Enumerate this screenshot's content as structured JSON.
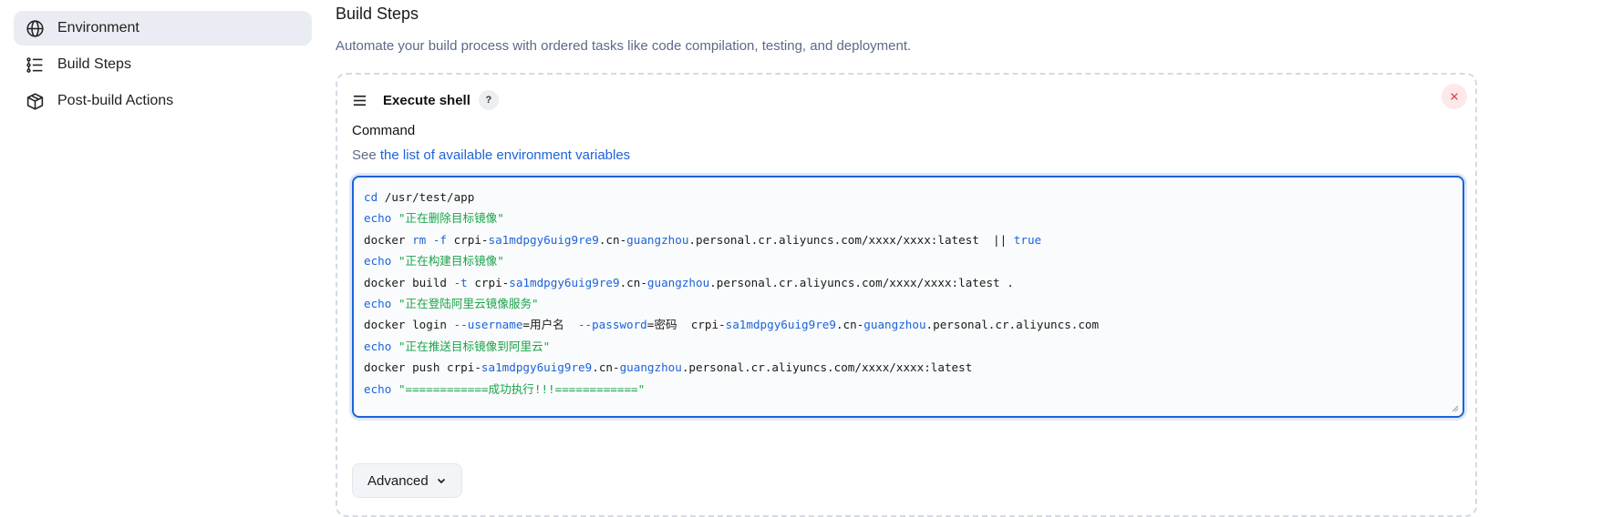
{
  "sidebar": {
    "items": [
      {
        "label": "Environment",
        "icon": "globe-icon",
        "active": true
      },
      {
        "label": "Build Steps",
        "icon": "list-icon",
        "active": false
      },
      {
        "label": "Post-build Actions",
        "icon": "package-icon",
        "active": false
      }
    ]
  },
  "section": {
    "title": "Build Steps",
    "description": "Automate your build process with ordered tasks like code compilation, testing, and deployment."
  },
  "step": {
    "title": "Execute shell",
    "help": "?",
    "field_label": "Command",
    "help_prefix": "See ",
    "help_link": "the list of available environment variables",
    "code_lines": [
      [
        {
          "t": "kw",
          "v": "cd"
        },
        {
          "t": "p",
          "v": " /usr/test/app"
        }
      ],
      [
        {
          "t": "kw",
          "v": "echo"
        },
        {
          "t": "p",
          "v": " "
        },
        {
          "t": "str",
          "v": "\"正在删除目标镜像\""
        }
      ],
      [
        {
          "t": "p",
          "v": "docker "
        },
        {
          "t": "kw",
          "v": "rm -f"
        },
        {
          "t": "p",
          "v": " crpi-"
        },
        {
          "t": "kw",
          "v": "sa1mdpgy6uig9re9"
        },
        {
          "t": "p",
          "v": ".cn-"
        },
        {
          "t": "kw",
          "v": "guangzhou"
        },
        {
          "t": "p",
          "v": ".personal.cr.aliyuncs.com/xxxx/xxxx:latest  || "
        },
        {
          "t": "kw",
          "v": "true"
        }
      ],
      [
        {
          "t": "kw",
          "v": "echo"
        },
        {
          "t": "p",
          "v": " "
        },
        {
          "t": "str",
          "v": "\"正在构建目标镜像\""
        }
      ],
      [
        {
          "t": "p",
          "v": "docker build "
        },
        {
          "t": "kw",
          "v": "-t"
        },
        {
          "t": "p",
          "v": " crpi-"
        },
        {
          "t": "kw",
          "v": "sa1mdpgy6uig9re9"
        },
        {
          "t": "p",
          "v": ".cn-"
        },
        {
          "t": "kw",
          "v": "guangzhou"
        },
        {
          "t": "p",
          "v": ".personal.cr.aliyuncs.com/xxxx/xxxx:latest ."
        }
      ],
      [
        {
          "t": "kw",
          "v": "echo"
        },
        {
          "t": "p",
          "v": " "
        },
        {
          "t": "str",
          "v": "\"正在登陆阿里云镜像服务\""
        }
      ],
      [
        {
          "t": "p",
          "v": "docker login "
        },
        {
          "t": "kw",
          "v": "--username"
        },
        {
          "t": "p",
          "v": "=用户名  "
        },
        {
          "t": "kw",
          "v": "--password"
        },
        {
          "t": "p",
          "v": "=密码  crpi-"
        },
        {
          "t": "kw",
          "v": "sa1mdpgy6uig9re9"
        },
        {
          "t": "p",
          "v": ".cn-"
        },
        {
          "t": "kw",
          "v": "guangzhou"
        },
        {
          "t": "p",
          "v": ".personal.cr.aliyuncs.com"
        }
      ],
      [
        {
          "t": "kw",
          "v": "echo"
        },
        {
          "t": "p",
          "v": " "
        },
        {
          "t": "str",
          "v": "\"正在推送目标镜像到阿里云\""
        }
      ],
      [
        {
          "t": "p",
          "v": "docker push crpi-"
        },
        {
          "t": "kw",
          "v": "sa1mdpgy6uig9re9"
        },
        {
          "t": "p",
          "v": ".cn-"
        },
        {
          "t": "kw",
          "v": "guangzhou"
        },
        {
          "t": "p",
          "v": ".personal.cr.aliyuncs.com/xxxx/xxxx:latest"
        }
      ],
      [
        {
          "t": "kw",
          "v": "echo"
        },
        {
          "t": "p",
          "v": " "
        },
        {
          "t": "str",
          "v": "\"============成功执行!!!============\""
        }
      ]
    ],
    "advanced_label": "Advanced"
  },
  "colors": {
    "accent": "#1d63d9",
    "string": "#1aa34a",
    "danger": "#e53b4a",
    "active_bg": "#e9ecf2"
  }
}
